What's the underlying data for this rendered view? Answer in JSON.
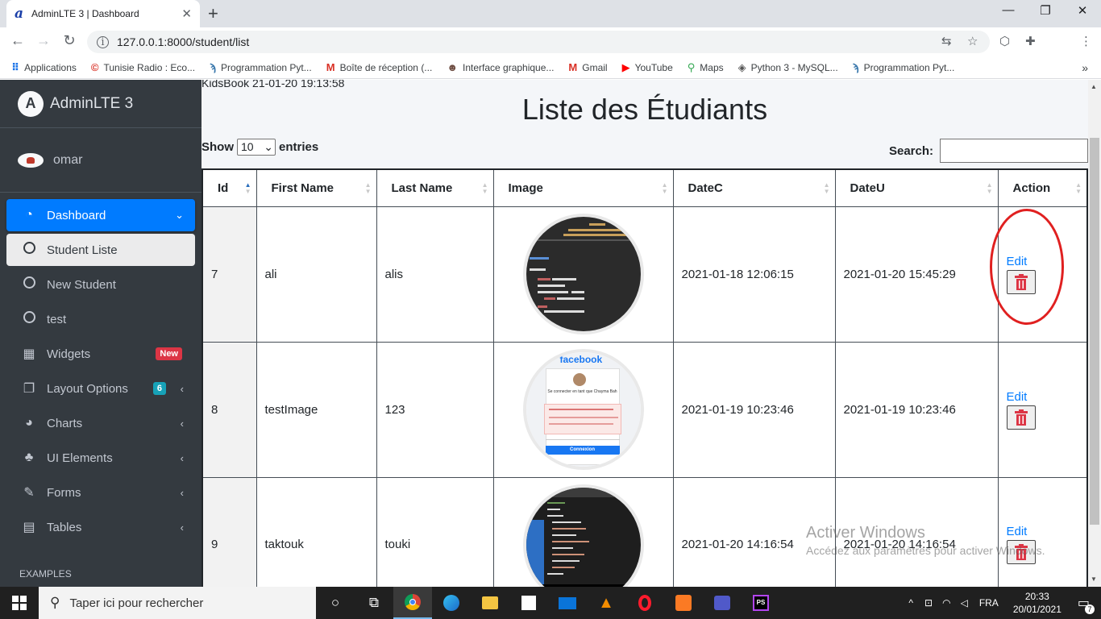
{
  "browser": {
    "tab_title": "AdminLTE 3 | Dashboard",
    "url": "127.0.0.1:8000/student/list",
    "bookmarks": [
      {
        "label": "Applications",
        "icon": "apps-grid-icon"
      },
      {
        "label": "Tunisie Radio : Eco...",
        "icon": "radio-icon"
      },
      {
        "label": "Programmation Pyt...",
        "icon": "python-icon"
      },
      {
        "label": "Boîte de réception (...",
        "icon": "gmail-icon"
      },
      {
        "label": "Interface graphique...",
        "icon": "avatar-icon"
      },
      {
        "label": "Gmail",
        "icon": "gmail-icon"
      },
      {
        "label": "YouTube",
        "icon": "youtube-icon"
      },
      {
        "label": "Maps",
        "icon": "maps-pin-icon"
      },
      {
        "label": "Python 3 - MySQL...",
        "icon": "diamond-icon"
      },
      {
        "label": "Programmation Pyt...",
        "icon": "python-icon"
      }
    ]
  },
  "sidebar": {
    "brand": "AdminLTE 3",
    "user": "omar",
    "items": [
      {
        "label": "Dashboard",
        "icon": "dashboard-gauge-icon",
        "state": "active"
      },
      {
        "label": "Student Liste",
        "icon": "circle-icon",
        "state": "sub-active"
      },
      {
        "label": "New Student",
        "icon": "circle-icon"
      },
      {
        "label": "test",
        "icon": "circle-icon"
      },
      {
        "label": "Widgets",
        "icon": "grid-icon",
        "badge": "New"
      },
      {
        "label": "Layout Options",
        "icon": "copy-icon",
        "badge": "6"
      },
      {
        "label": "Charts",
        "icon": "pie-chart-icon"
      },
      {
        "label": "UI Elements",
        "icon": "tree-icon"
      },
      {
        "label": "Forms",
        "icon": "edit-icon"
      },
      {
        "label": "Tables",
        "icon": "table-icon"
      }
    ],
    "section_header": "EXAMPLES"
  },
  "content": {
    "cut_text": "KidsBook 21-01-20 19:13:58",
    "title": "Liste des Étudiants",
    "show_label": "Show",
    "entries_value": "10",
    "entries_label": "entries",
    "search_label": "Search:",
    "columns": [
      "Id",
      "First Name",
      "Last Name",
      "Image",
      "DateC",
      "DateU",
      "Action"
    ],
    "rows": [
      {
        "id": "7",
        "first": "ali",
        "last": "alis",
        "datec": "2021-01-18 12:06:15",
        "dateu": "2021-01-20 15:45:29",
        "edit": "Edit"
      },
      {
        "id": "8",
        "first": "testImage",
        "last": "123",
        "datec": "2021-01-19 10:23:46",
        "dateu": "2021-01-19 10:23:46",
        "edit": "Edit"
      },
      {
        "id": "9",
        "first": "taktouk",
        "last": "touki",
        "datec": "2021-01-20 14:16:54",
        "dateu": "2021-01-20 14:16:54",
        "edit": "Edit"
      }
    ],
    "img2_facebook": "facebook",
    "img2_button": "Connexion",
    "img2_caption": "Se connecter en tant que Chayma Bah"
  },
  "watermark": {
    "line1": "Activer Windows",
    "line2": "Accédez aux paramètres pour activer Windows."
  },
  "taskbar": {
    "search_placeholder": "Taper ici pour rechercher",
    "lang": "FRA",
    "time": "20:33",
    "date": "20/01/2021",
    "notifications": "7"
  },
  "colors": {
    "sidebar_bg": "#343a40",
    "active_blue": "#007bff",
    "delete_red": "#dc3545",
    "annotation_red": "#e02020"
  }
}
